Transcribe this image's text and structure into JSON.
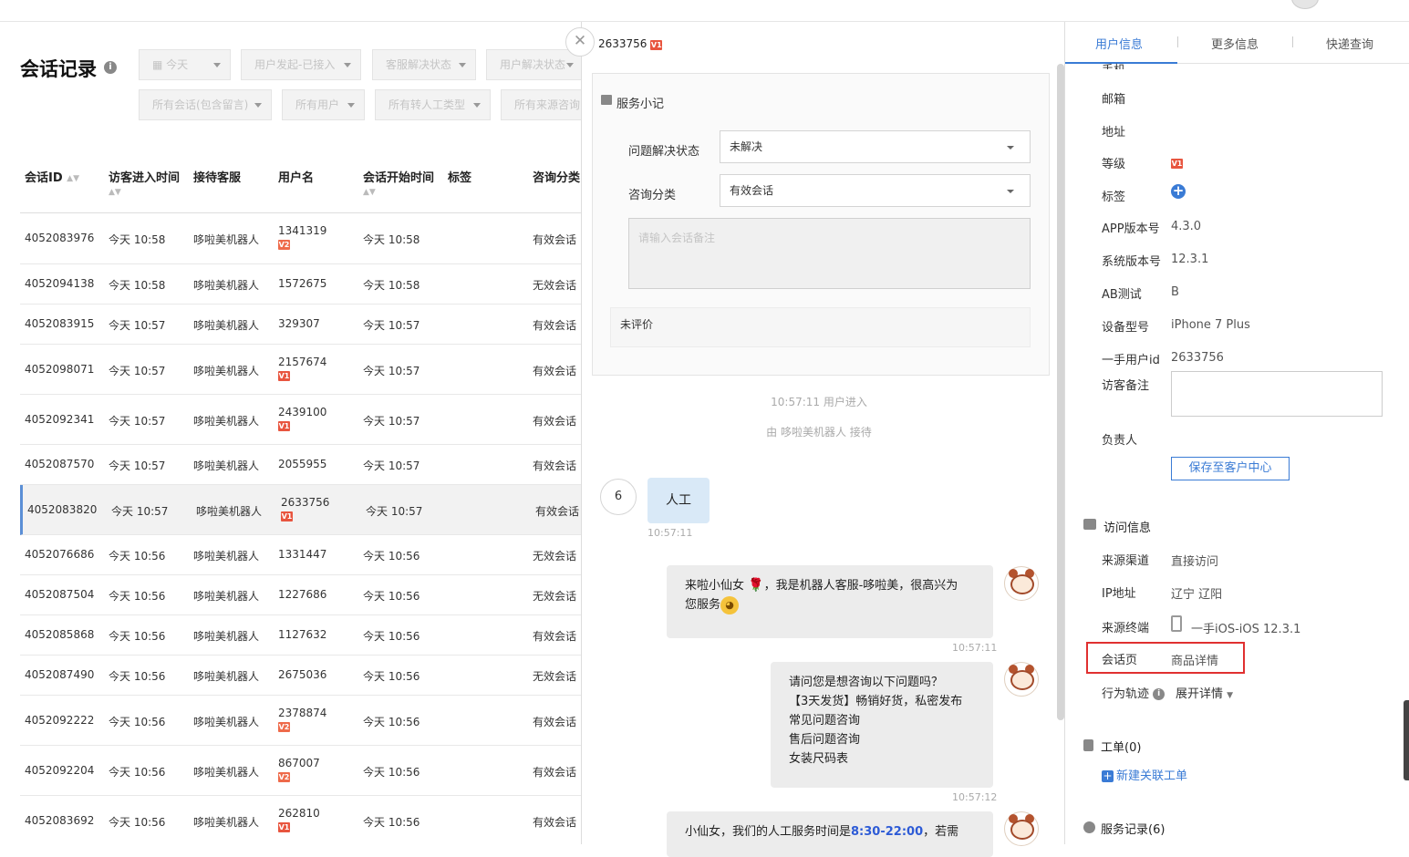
{
  "left": {
    "title": "会话记录",
    "filters": [
      "今天",
      "用户发起-已接入",
      "客服解决状态",
      "用户解决状态",
      "所有会话(包含留言)",
      "所有用户",
      "所有转人工类型",
      "所有来源咨询"
    ],
    "columns": [
      "会话ID",
      "访客进入时间",
      "接待客服",
      "用户名",
      "会话开始时间",
      "标签",
      "咨询分类"
    ],
    "rows": [
      {
        "id": "4052083976",
        "enter": "今天 10:58",
        "agent": "哆啦美机器人",
        "user": "1341319",
        "badge": "V2",
        "start": "今天 10:58",
        "cat": "有效会话"
      },
      {
        "id": "4052094138",
        "enter": "今天 10:58",
        "agent": "哆啦美机器人",
        "user": "1572675",
        "badge": "",
        "start": "今天 10:58",
        "cat": "无效会话"
      },
      {
        "id": "4052083915",
        "enter": "今天 10:57",
        "agent": "哆啦美机器人",
        "user": "329307",
        "badge": "",
        "start": "今天 10:57",
        "cat": "有效会话"
      },
      {
        "id": "4052098071",
        "enter": "今天 10:57",
        "agent": "哆啦美机器人",
        "user": "2157674",
        "badge": "V1",
        "start": "今天 10:57",
        "cat": "有效会话"
      },
      {
        "id": "4052092341",
        "enter": "今天 10:57",
        "agent": "哆啦美机器人",
        "user": "2439100",
        "badge": "V1",
        "start": "今天 10:57",
        "cat": "有效会话"
      },
      {
        "id": "4052087570",
        "enter": "今天 10:57",
        "agent": "哆啦美机器人",
        "user": "2055955",
        "badge": "",
        "start": "今天 10:57",
        "cat": "有效会话"
      },
      {
        "id": "4052083820",
        "enter": "今天 10:57",
        "agent": "哆啦美机器人",
        "user": "2633756",
        "badge": "V1",
        "start": "今天 10:57",
        "cat": "有效会话"
      },
      {
        "id": "4052076686",
        "enter": "今天 10:56",
        "agent": "哆啦美机器人",
        "user": "1331447",
        "badge": "",
        "start": "今天 10:56",
        "cat": "无效会话"
      },
      {
        "id": "4052087504",
        "enter": "今天 10:56",
        "agent": "哆啦美机器人",
        "user": "1227686",
        "badge": "",
        "start": "今天 10:56",
        "cat": "无效会话"
      },
      {
        "id": "4052085868",
        "enter": "今天 10:56",
        "agent": "哆啦美机器人",
        "user": "1127632",
        "badge": "",
        "start": "今天 10:56",
        "cat": "有效会话"
      },
      {
        "id": "4052087490",
        "enter": "今天 10:56",
        "agent": "哆啦美机器人",
        "user": "2675036",
        "badge": "",
        "start": "今天 10:56",
        "cat": "无效会话"
      },
      {
        "id": "4052092222",
        "enter": "今天 10:56",
        "agent": "哆啦美机器人",
        "user": "2378874",
        "badge": "V2",
        "start": "今天 10:56",
        "cat": "有效会话"
      },
      {
        "id": "4052092204",
        "enter": "今天 10:56",
        "agent": "哆啦美机器人",
        "user": "867007",
        "badge": "V2",
        "start": "今天 10:56",
        "cat": "有效会话"
      },
      {
        "id": "4052083692",
        "enter": "今天 10:56",
        "agent": "哆啦美机器人",
        "user": "262810",
        "badge": "V1",
        "start": "今天 10:56",
        "cat": "有效会话"
      }
    ]
  },
  "mid": {
    "uid": "2633756",
    "uid_badge": "V1",
    "note_title": "服务小记",
    "solve_label": "问题解决状态",
    "solve_value": "未解决",
    "category_label": "咨询分类",
    "category_value": "有效会话",
    "remark_placeholder": "请输入会话备注",
    "rating": "未评价",
    "sys1": "10:57:11 用户进入",
    "sys2": "由 哆啦美机器人 接待",
    "user_msg_count": "6",
    "user_msg": "人工",
    "user_msg_time": "10:57:11",
    "bot1_pre": "来啦小仙女",
    "bot1_mid": "，我是机器人客服-哆啦美，很高兴为",
    "bot1_line2": "您服务",
    "bot1_time": "10:57:11",
    "bot2_lines": [
      "请问您是想咨询以下问题吗？",
      "【3天发货】畅销好货，私密发布",
      "常见问题咨询",
      "售后问题咨询",
      "女装尺码表"
    ],
    "bot2_time": "10:57:12",
    "bot3_pre": "小仙女，我们的人工服务时间是",
    "bot3_hours": "8:30-22:00",
    "bot3_post": "，若需"
  },
  "right": {
    "tabs": [
      "用户信息",
      "更多信息",
      "快递查询"
    ],
    "cut_label": "手机",
    "fields": {
      "email": "邮箱",
      "address": "地址",
      "level": "等级",
      "level_badge": "V1",
      "tag": "标签",
      "app_ver_label": "APP版本号",
      "app_ver": "4.3.0",
      "sys_ver_label": "系统版本号",
      "sys_ver": "12.3.1",
      "ab_label": "AB测试",
      "ab": "B",
      "device_label": "设备型号",
      "device": "iPhone 7 Plus",
      "uid_label": "一手用户id",
      "uid": "2633756",
      "visitor_note_label": "访客备注",
      "owner_label": "负责人",
      "save_btn": "保存至客户中心"
    },
    "visit": {
      "title": "访问信息",
      "channel_label": "来源渠道",
      "channel": "直接访问",
      "ip_label": "IP地址",
      "ip": "辽宁 辽阳",
      "terminal_label": "来源终端",
      "terminal": "一手iOS-iOS 12.3.1",
      "page_label": "会话页",
      "page": "商品详情",
      "track_label": "行为轨迹",
      "track_link": "展开详情"
    },
    "ticket_title": "工单(0)",
    "new_ticket": "新建关联工单",
    "service_record": "服务记录(6)"
  }
}
